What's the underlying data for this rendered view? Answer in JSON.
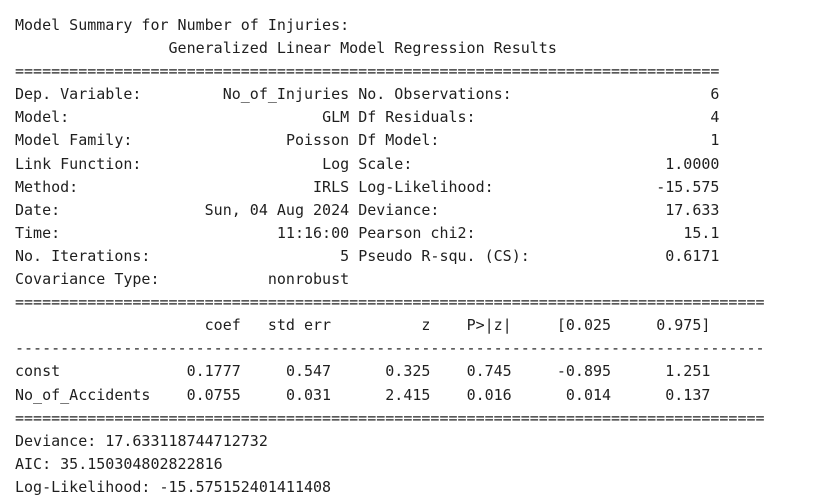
{
  "output": {
    "header": "Model Summary for Number of Injuries:",
    "title": "Generalized Linear Model Regression Results",
    "info_separator": "==============================================================================",
    "info_rows": [
      {
        "left_label": "Dep. Variable:",
        "left_value": "No_of_Injuries",
        "right_label": "No. Observations:",
        "right_value": "6"
      },
      {
        "left_label": "Model:",
        "left_value": "GLM",
        "right_label": "Df Residuals:",
        "right_value": "4"
      },
      {
        "left_label": "Model Family:",
        "left_value": "Poisson",
        "right_label": "Df Model:",
        "right_value": "1"
      },
      {
        "left_label": "Link Function:",
        "left_value": "Log",
        "right_label": "Scale:",
        "right_value": "1.0000"
      },
      {
        "left_label": "Method:",
        "left_value": "IRLS",
        "right_label": "Log-Likelihood:",
        "right_value": "-15.575"
      },
      {
        "left_label": "Date:",
        "left_value": "Sun, 04 Aug 2024",
        "right_label": "Deviance:",
        "right_value": "17.633"
      },
      {
        "left_label": "Time:",
        "left_value": "11:16:00",
        "right_label": "Pearson chi2:",
        "right_value": "15.1"
      },
      {
        "left_label": "No. Iterations:",
        "left_value": "5",
        "right_label": "Pseudo R-squ. (CS):",
        "right_value": "0.6171"
      },
      {
        "left_label": "Covariance Type:",
        "left_value": "nonrobust",
        "right_label": "",
        "right_value": ""
      }
    ],
    "coef_separator": "===================================================================================",
    "coef_dash": "-----------------------------------------------------------------------------------",
    "coef_columns": [
      "coef",
      "std err",
      "z",
      "P>|z|",
      "[0.025",
      "0.975]"
    ],
    "coef_rows": [
      {
        "name": "const",
        "values": [
          "0.1777",
          "0.547",
          "0.325",
          "0.745",
          "-0.895",
          "1.251"
        ]
      },
      {
        "name": "No_of_Accidents",
        "values": [
          "0.0755",
          "0.031",
          "2.415",
          "0.016",
          "0.014",
          "0.137"
        ]
      }
    ],
    "stats": [
      "Deviance: 17.633118744712732",
      "AIC: 35.150304802822816",
      "Log-Likelihood: -15.575152401411408"
    ]
  }
}
